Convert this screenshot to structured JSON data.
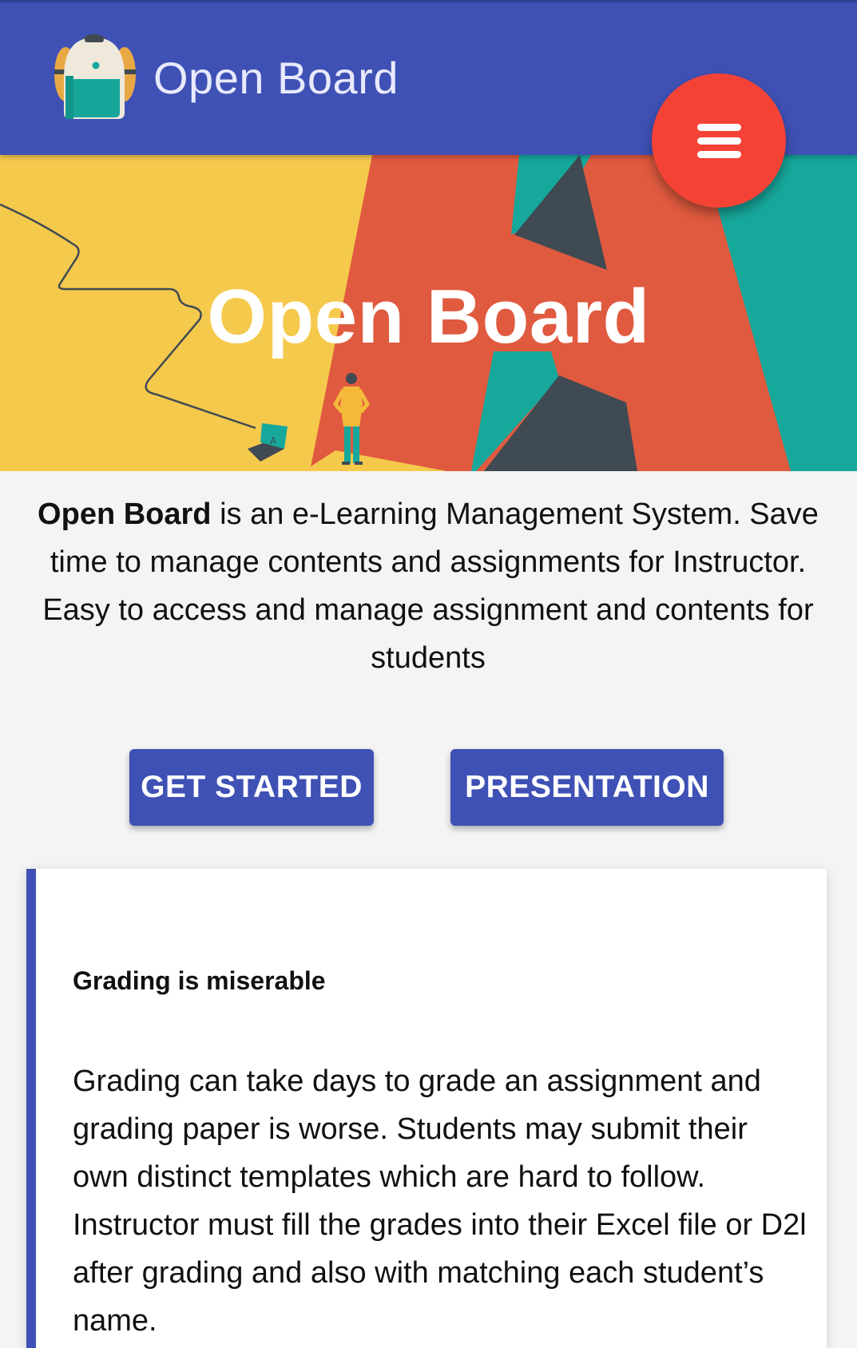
{
  "appbar": {
    "title": "Open Board",
    "logo_icon": "backpack-icon",
    "menu_icon": "hamburger-menu-icon",
    "background": "#3f51b5",
    "fab_color": "#f44336"
  },
  "hero": {
    "title": "Open Board",
    "illustration": "abstract-shapes-with-person-and-laptop",
    "laptop_screen_letter": "A",
    "colors": {
      "yellow": "#f5c94c",
      "red": "#e05a3f",
      "teal": "#17a89c",
      "dark": "#3f4a52"
    }
  },
  "intro": {
    "brand": "Open Board",
    "text": " is an e-Learning Management System. Save time to manage contents and assignments for Instructor. Easy to access and manage assignment and contents for students"
  },
  "buttons": {
    "get_started": "GET STARTED",
    "presentation": "PRESENTATION"
  },
  "card": {
    "title": "Grading is miserable",
    "body": "Grading can take days to grade an assignment and grading paper is worse. Students may submit their own distinct templates which are hard to follow. Instructor must fill the grades into their Excel file or D2l after grading and also with matching each student’s name."
  }
}
